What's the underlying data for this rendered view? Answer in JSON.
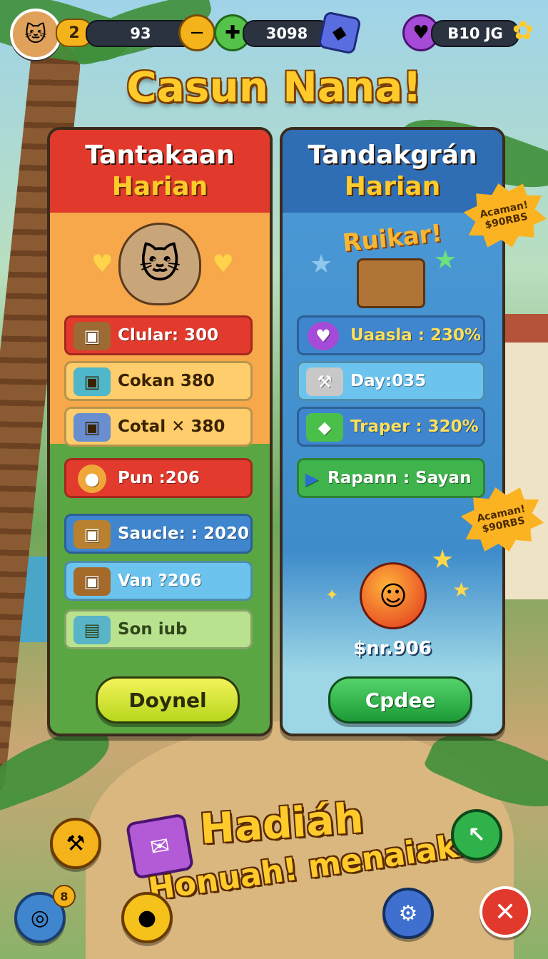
{
  "colors": {
    "title": "#ffcb2b",
    "left_panel_header": "#e2392d",
    "right_panel_header": "#2f6db4",
    "accent_yellow": "#fbb321"
  },
  "hud": {
    "avatar_icon": "cat-face-icon",
    "level": "2",
    "coins": {
      "icon": "coin-icon",
      "value": "93"
    },
    "clovers": {
      "icon": "clover-icon",
      "value": "3098"
    },
    "gems_icon": "gem-icon",
    "hearts": {
      "icon": "purple-heart-icon",
      "value": "B10 JG"
    },
    "stars_icon": "star-flower-icon"
  },
  "page_title": "Casun Nana!",
  "left_panel": {
    "title_line1": "Tantakaan",
    "title_line2": "Harian",
    "items": [
      {
        "label": "Clular: 300",
        "icon": "chest-icon",
        "style": "red"
      },
      {
        "label": "Cokan 380",
        "icon": "chest-icon",
        "style": "orange"
      },
      {
        "label": "Cotal ✕ 380",
        "icon": "chest-icon",
        "style": "orange"
      },
      {
        "label": "Pun :206",
        "icon": "orb-icon",
        "style": "red"
      },
      {
        "label": "Saucle: : 2020",
        "icon": "chest-icon",
        "style": "blue"
      },
      {
        "label": "Van ?206",
        "icon": "chest-icon",
        "style": "lblue"
      },
      {
        "label": "Son iub",
        "icon": "book-icon",
        "style": "lgreen"
      }
    ],
    "button": "Doynel"
  },
  "right_panel": {
    "title_line1": "Tandakgrán",
    "title_line2": "Harian",
    "banner_text": "Ruikar!",
    "items": [
      {
        "label": "Uaasla : 230%",
        "icon": "purple-heart-icon",
        "style": "blue"
      },
      {
        "label": "Day:035",
        "icon": "hammer-icon",
        "style": "lblue"
      },
      {
        "label": "Traper : 320%",
        "icon": "green-gem-icon",
        "style": "blue"
      },
      {
        "label": "Rapann : Sayan",
        "icon": "play-icon",
        "style": "green"
      }
    ],
    "reward_amount": "$nr.906",
    "button": "Cpdee"
  },
  "badges": [
    {
      "line1": "Acaman!",
      "line2": "$90RBS"
    },
    {
      "line1": "Acaman!",
      "line2": "$90RBS"
    }
  ],
  "bottom": {
    "title_line1": "Hadiáh",
    "title_line2": "Honuah! menaiak:"
  },
  "corner_buttons": {
    "bottom_left_top": "hammer-coin-icon",
    "bottom_left": "donut-icon",
    "bottom_left_badge": "8",
    "bottom_center_left": "gold-coin-icon",
    "bottom_center_right": "gear-blue-icon",
    "top_right": "green-arrow-icon",
    "close": "close-icon"
  }
}
